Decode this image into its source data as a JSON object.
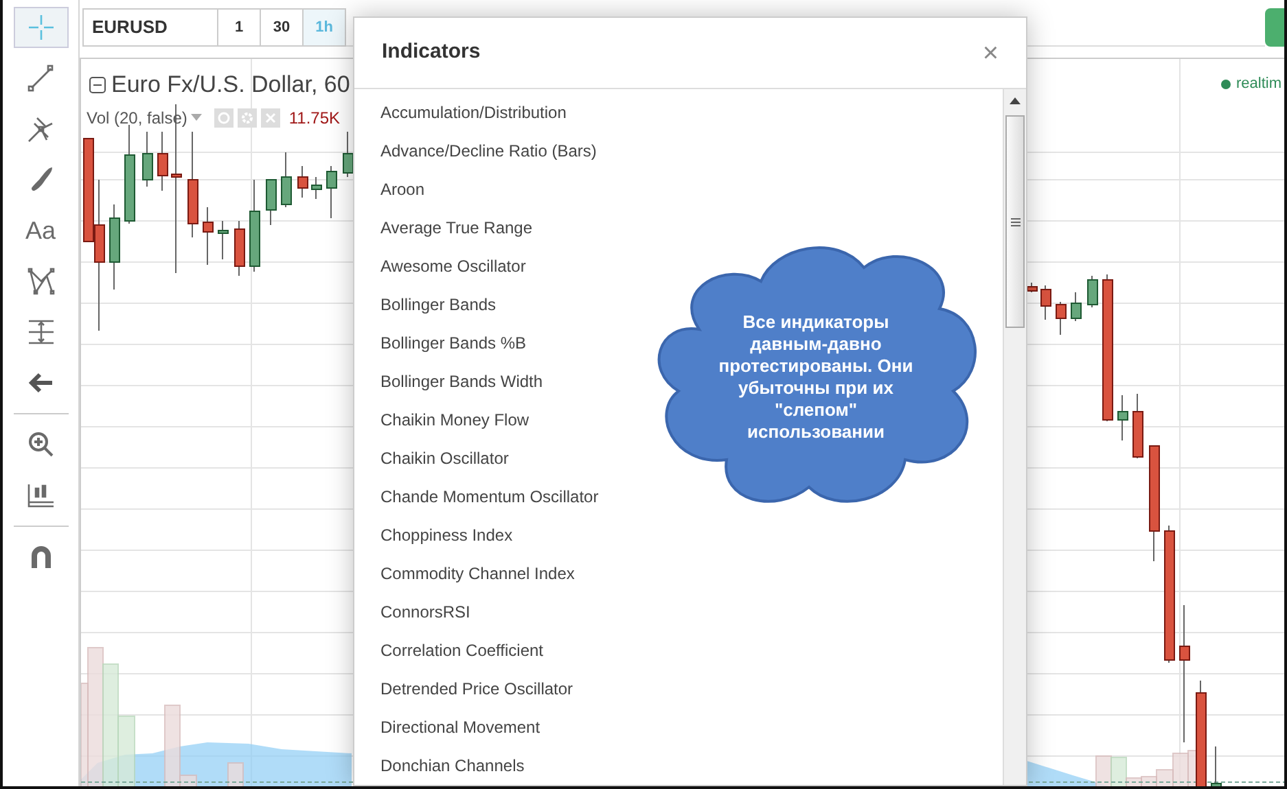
{
  "tools": [
    {
      "kind": "crosshair",
      "selected": true
    },
    {
      "kind": "line",
      "selected": false
    },
    {
      "kind": "pitchfork",
      "selected": false
    },
    {
      "kind": "brush",
      "selected": false
    },
    {
      "kind": "text",
      "label": "Aa",
      "selected": false
    },
    {
      "kind": "pattern",
      "selected": false
    },
    {
      "kind": "measure",
      "selected": false
    },
    {
      "kind": "arrow",
      "selected": false
    },
    {
      "kind": "divider"
    },
    {
      "kind": "zoom",
      "selected": false
    },
    {
      "kind": "bars",
      "selected": false
    },
    {
      "kind": "divider"
    },
    {
      "kind": "magnet",
      "selected": false
    }
  ],
  "symbol": "EURUSD",
  "intervals": [
    {
      "label": "1",
      "selected": false
    },
    {
      "label": "30",
      "selected": false
    },
    {
      "label": "1h",
      "selected": true
    }
  ],
  "chart": {
    "title": "Euro Fx/U.S. Dollar, 60",
    "study": "Vol (20, false)",
    "study_value": "11.75K",
    "status": "realtim"
  },
  "dialog": {
    "title": "Indicators",
    "close": "×",
    "items": [
      "Accumulation/Distribution",
      "Advance/Decline Ratio (Bars)",
      "Aroon",
      "Average True Range",
      "Awesome Oscillator",
      "Bollinger Bands",
      "Bollinger Bands %B",
      "Bollinger Bands Width",
      "Chaikin Money Flow",
      "Chaikin Oscillator",
      "Chande Momentum Oscillator",
      "Choppiness Index",
      "Commodity Channel Index",
      "ConnorsRSI",
      "Correlation Coefficient",
      "Detrended Price Oscillator",
      "Directional Movement",
      "Donchian Channels"
    ]
  },
  "callout": {
    "text": "Все индикаторы давным-давно протестированы. Они убыточны при их \"слепом\" использовании"
  }
}
